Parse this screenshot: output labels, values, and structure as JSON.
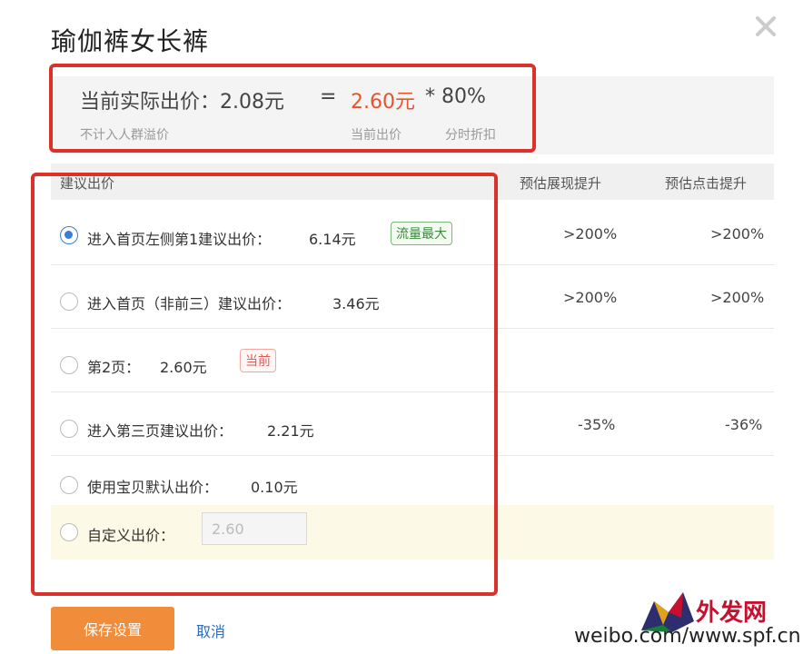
{
  "dialog": {
    "title": "瑜伽裤女长裤",
    "close_icon": "close-icon"
  },
  "summary": {
    "actual_label": "当前实际出价：2.08元",
    "equals": "=",
    "current_price": "2.60元",
    "multiplier": "* 80%",
    "sub_actual": "不计入人群溢价",
    "sub_current": "当前出价",
    "sub_discount": "分时折扣"
  },
  "table": {
    "headers": {
      "suggest": "建议出价",
      "exposure": "预估展现提升",
      "clicks": "预估点击提升"
    },
    "rows": [
      {
        "label": "进入首页左侧第1建议出价：",
        "value": "6.14元",
        "badge": "流量最大",
        "exposure": ">200%",
        "clicks": ">200%",
        "checked": true
      },
      {
        "label": "进入首页（非前三）建议出价：",
        "value": "3.46元",
        "badge": "",
        "exposure": ">200%",
        "clicks": ">200%",
        "checked": false
      },
      {
        "label": "第2页：",
        "value": "2.60元",
        "badge": "当前",
        "exposure": "",
        "clicks": "",
        "checked": false
      },
      {
        "label": "进入第三页建议出价：",
        "value": "2.21元",
        "badge": "",
        "exposure": "-35%",
        "clicks": "-36%",
        "checked": false
      },
      {
        "label": "使用宝贝默认出价：",
        "value": "0.10元",
        "badge": "",
        "exposure": "",
        "clicks": "",
        "checked": false
      }
    ],
    "custom": {
      "label": "自定义出价：",
      "value": "2.60"
    }
  },
  "footer": {
    "save_label": "保存设置",
    "cancel_label": "取消"
  },
  "watermark": {
    "text": "weibo.com/www.spf.cn",
    "brand": "外发网",
    "url": "www.spf.cn"
  },
  "colors": {
    "accent_red": "#d9322a",
    "price_red": "#e6532d",
    "save_orange": "#f08c3a",
    "radio_blue": "#3a7fd5",
    "link_blue": "#2b6ac8"
  }
}
